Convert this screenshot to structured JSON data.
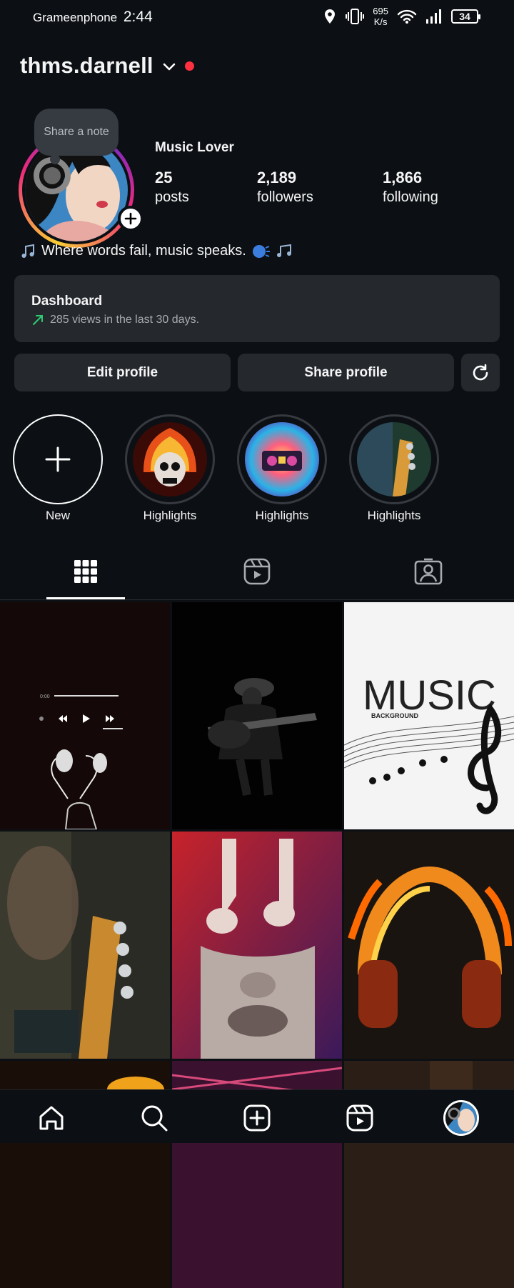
{
  "status_bar": {
    "carrier": "Grameenphone",
    "time": "2:44",
    "net_speed_value": "695",
    "net_speed_unit": "K/s",
    "battery": "34"
  },
  "header": {
    "username": "thms.darnell"
  },
  "profile": {
    "note_bubble": "Share a note",
    "display_name": "Music Lover",
    "stats": [
      {
        "value": "25",
        "label": "posts"
      },
      {
        "value": "2,189",
        "label": "followers"
      },
      {
        "value": "1,866",
        "label": "following"
      }
    ],
    "bio": "Where words fail, music speaks."
  },
  "dashboard": {
    "title": "Dashboard",
    "subtitle": "285 views in the last 30 days."
  },
  "buttons": {
    "edit": "Edit profile",
    "share": "Share profile"
  },
  "highlights": [
    {
      "label": "New"
    },
    {
      "label": "Highlights"
    },
    {
      "label": "Highlights"
    },
    {
      "label": "Highlights"
    }
  ],
  "posts": {
    "post_3_title": "MUSIC",
    "post_3_subtitle": "BACKGROUND"
  },
  "colors": {
    "background": "#0c1014",
    "surface": "#25292e",
    "accent_red": "#ff3040",
    "trend_green": "#2ecc71"
  }
}
